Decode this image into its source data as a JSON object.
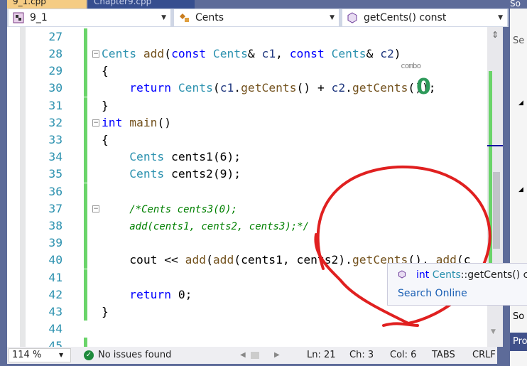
{
  "tabs": [
    {
      "label": "9_1.cpp",
      "pin": "⊤",
      "close": "✕"
    },
    {
      "label": "Chapter9.cpp"
    }
  ],
  "navbar": {
    "project": "9_1",
    "scope": "Cents",
    "member": "getCents() const"
  },
  "code": [
    {
      "n": "27",
      "t": []
    },
    {
      "n": "28",
      "fold": "−",
      "t": [
        [
          "Cents",
          "ty"
        ],
        [
          " ",
          "tx"
        ],
        [
          "add",
          "fn"
        ],
        [
          "(",
          "tx"
        ],
        [
          "const",
          "kw"
        ],
        [
          " ",
          "tx"
        ],
        [
          "Cents",
          "ty"
        ],
        [
          "& ",
          "tx"
        ],
        [
          "c1",
          "pa"
        ],
        [
          ", ",
          "tx"
        ],
        [
          "const",
          "kw"
        ],
        [
          " ",
          "tx"
        ],
        [
          "Cents",
          "ty"
        ],
        [
          "& ",
          "tx"
        ],
        [
          "c2",
          "pa"
        ],
        [
          ")",
          "tx"
        ]
      ]
    },
    {
      "n": "29",
      "t": [
        [
          "{",
          "tx"
        ]
      ]
    },
    {
      "n": "30",
      "t": [
        [
          "    ",
          "tx"
        ],
        [
          "return",
          "kw"
        ],
        [
          " ",
          "tx"
        ],
        [
          "Cents",
          "ty"
        ],
        [
          "(",
          "tx"
        ],
        [
          "c1",
          "pa"
        ],
        [
          ".",
          "tx"
        ],
        [
          "getCents",
          "fn"
        ],
        [
          "() + ",
          "tx"
        ],
        [
          "c2",
          "pa"
        ],
        [
          ".",
          "tx"
        ],
        [
          "getCents",
          "fn"
        ],
        [
          "());",
          "tx"
        ]
      ]
    },
    {
      "n": "31",
      "t": [
        [
          "}",
          "tx"
        ]
      ]
    },
    {
      "n": "32",
      "fold": "−",
      "t": [
        [
          "int",
          "kw"
        ],
        [
          " ",
          "tx"
        ],
        [
          "main",
          "fn"
        ],
        [
          "()",
          "tx"
        ]
      ]
    },
    {
      "n": "33",
      "t": [
        [
          "{",
          "tx"
        ]
      ]
    },
    {
      "n": "34",
      "t": [
        [
          "    ",
          "tx"
        ],
        [
          "Cents",
          "ty"
        ],
        [
          " cents1(6);",
          "tx"
        ]
      ]
    },
    {
      "n": "35",
      "t": [
        [
          "    ",
          "tx"
        ],
        [
          "Cents",
          "ty"
        ],
        [
          " cents2(9);",
          "tx"
        ]
      ]
    },
    {
      "n": "36",
      "t": []
    },
    {
      "n": "37",
      "fold": "−",
      "t": [
        [
          "    ",
          "tx"
        ],
        [
          "/*Cents cents3(0);",
          "cm"
        ]
      ]
    },
    {
      "n": "38",
      "t": [
        [
          "    ",
          "tx"
        ],
        [
          "add(cents1, cents2, cents3);*/",
          "cm"
        ]
      ]
    },
    {
      "n": "39",
      "t": []
    },
    {
      "n": "40",
      "t": [
        [
          "    cout << ",
          "tx"
        ],
        [
          "add",
          "fn"
        ],
        [
          "(",
          "tx"
        ],
        [
          "add",
          "fn"
        ],
        [
          "(cents1, cents2).",
          "tx"
        ],
        [
          "getCents",
          "fn"
        ],
        [
          "(), ",
          "tx"
        ],
        [
          "add",
          "fn"
        ],
        [
          "(c",
          "tx"
        ]
      ]
    },
    {
      "n": "41",
      "t": []
    },
    {
      "n": "42",
      "t": [
        [
          "    ",
          "tx"
        ],
        [
          "return",
          "kw"
        ],
        [
          " 0;",
          "tx"
        ]
      ]
    },
    {
      "n": "43",
      "t": [
        [
          "}",
          "tx"
        ]
      ]
    },
    {
      "n": "44",
      "t": []
    },
    {
      "n": "45",
      "t": []
    }
  ],
  "annotation": {
    "word": "combo",
    "mark": "0",
    "color": "#e02020"
  },
  "tooltip": {
    "kw": "int",
    "type": "Cents",
    "rest": "::getCents() co",
    "link": "Search Online"
  },
  "status": {
    "zoom": "114 %",
    "issues": "No issues found",
    "ln": "Ln: 21",
    "ch": "Ch: 3",
    "col": "Col: 6",
    "tabs": "TABS",
    "eol": "CRLF"
  },
  "right_panel": {
    "a": "So",
    "b": "Se",
    "c": "So",
    "d": "Pro"
  }
}
